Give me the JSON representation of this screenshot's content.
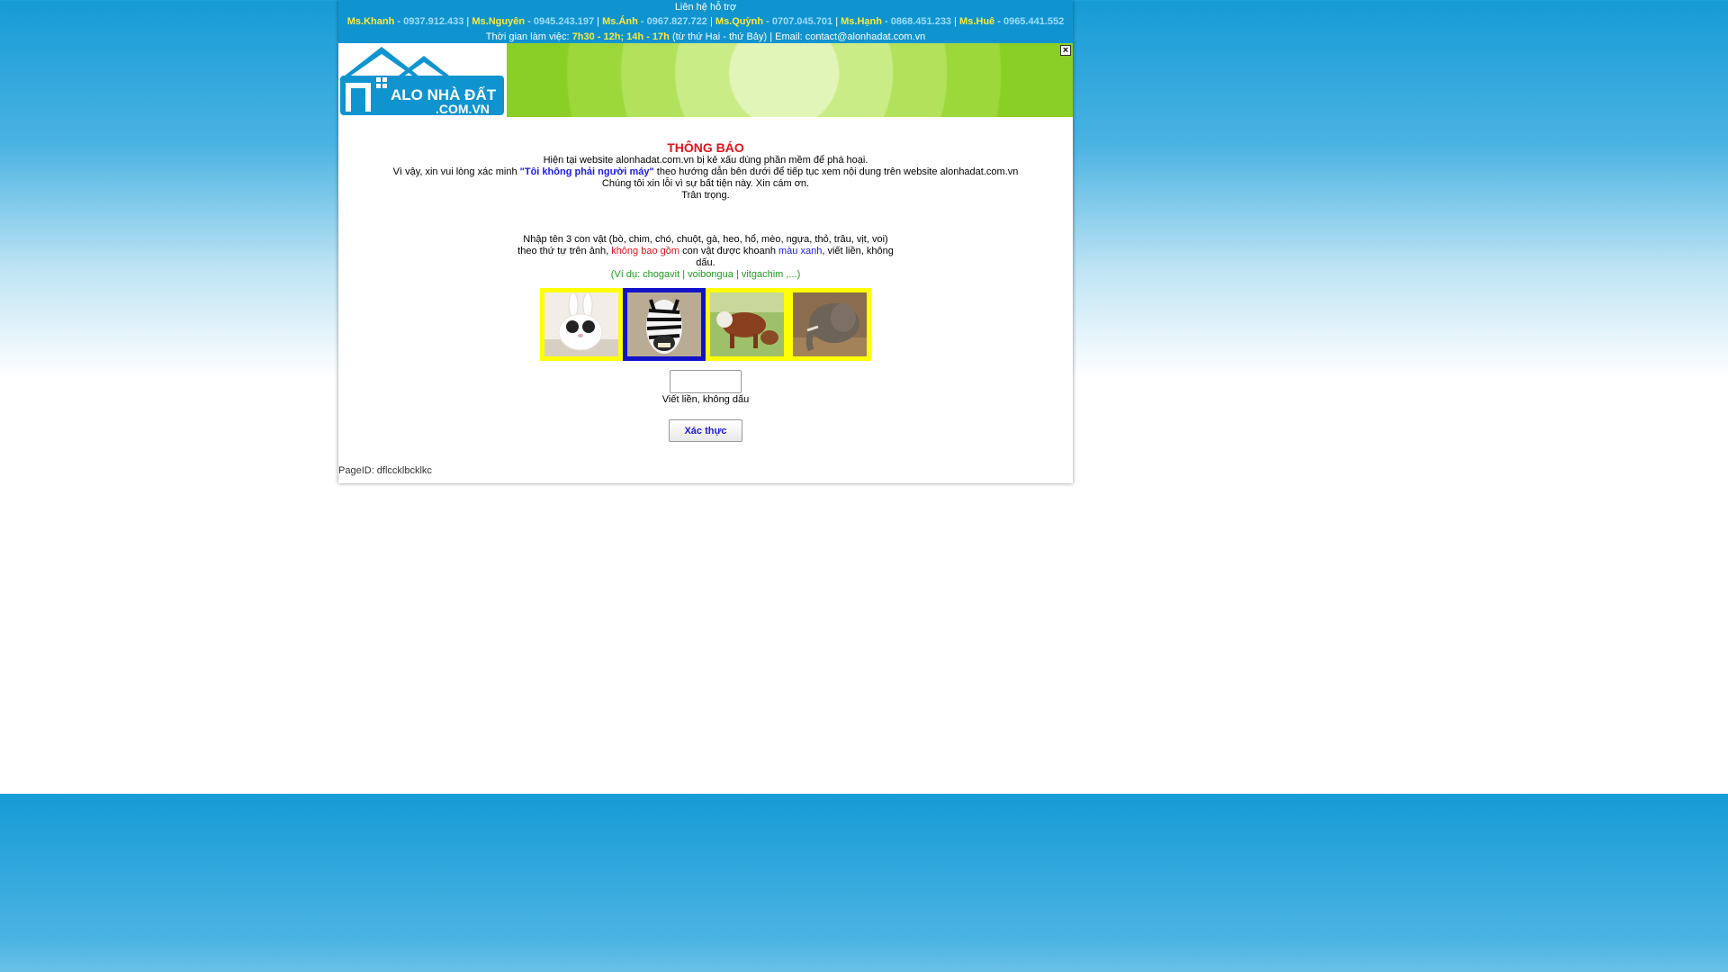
{
  "support": {
    "title": "Liên hệ hỗ trợ",
    "contacts": [
      {
        "name": "Ms.Khanh",
        "phone": "0937.912.433"
      },
      {
        "name": "Ms.Nguyên",
        "phone": "0945.243.197"
      },
      {
        "name": "Ms.Ánh",
        "phone": "0967.827.722"
      },
      {
        "name": "Ms.Quỳnh",
        "phone": "0707.045.701"
      },
      {
        "name": "Ms.Hạnh",
        "phone": "0868.451.233"
      },
      {
        "name": "Ms.Huê",
        "phone": "0965.441.552"
      }
    ],
    "hours_label": "Thời gian làm việc:",
    "hours_value": "7h30 - 12h; 14h - 17h",
    "days": "(từ thứ Hai - thứ Bảy) | Email: contact@alonhadat.com.vn"
  },
  "logo": {
    "line1": "ALO NHÀ ĐẤT",
    "line2": ".COM.VN"
  },
  "banner": {
    "close_label": "×"
  },
  "notice": {
    "title": "THÔNG BÁO",
    "line1": "Hiện tại website alonhadat.com.vn bị kẻ xấu dùng phần mềm để phá hoại.",
    "line2_before": "Vì vậy, xin vui lòng xác minh ",
    "line2_quote": "\"Tôi không phải người máy\"",
    "line2_after": " theo hướng dẫn bên dưới để tiếp tục xem nội dung trên website alonhadat.com.vn",
    "line3": "Chúng tôi xin lỗi vì sự bất tiện này. Xin cám ơn.",
    "line4": "Trân trọng."
  },
  "instruction": {
    "p1": "Nhập tên 3 con vật (bò, chim, chó, chuột, gà, heo, hổ, mèo, ngựa, thỏ, trâu, vịt, voi)",
    "p2a": "theo thứ tự trên ảnh, ",
    "p2b": "không bao gồm",
    "p2c": " con vật được khoanh ",
    "p2d": "màu xanh",
    "p2e": ", viết liền, không",
    "p3": "dấu.",
    "example": "(Ví dụ: chogavit | voibongua | vitgachim ,...)"
  },
  "animals": [
    {
      "name": "rabbit",
      "selected": false
    },
    {
      "name": "zebra",
      "selected": true
    },
    {
      "name": "cow",
      "selected": false
    },
    {
      "name": "elephant",
      "selected": false
    }
  ],
  "form": {
    "input_value": "",
    "hint": "Viết liền, không dấu",
    "submit_label": "Xác thực"
  },
  "footer": {
    "page_id": "PageID: dflccklbcklkc"
  },
  "colors": {
    "header_bg": "#0f94cf",
    "name_color": "#ffe93a",
    "phone_color": "#9fdcff",
    "notice_red": "#e0141b",
    "link_blue": "#1a1ae6",
    "example_green": "#1d9a1d",
    "selected_border": "#1212c8",
    "frame_yellow": "#ffff00"
  }
}
